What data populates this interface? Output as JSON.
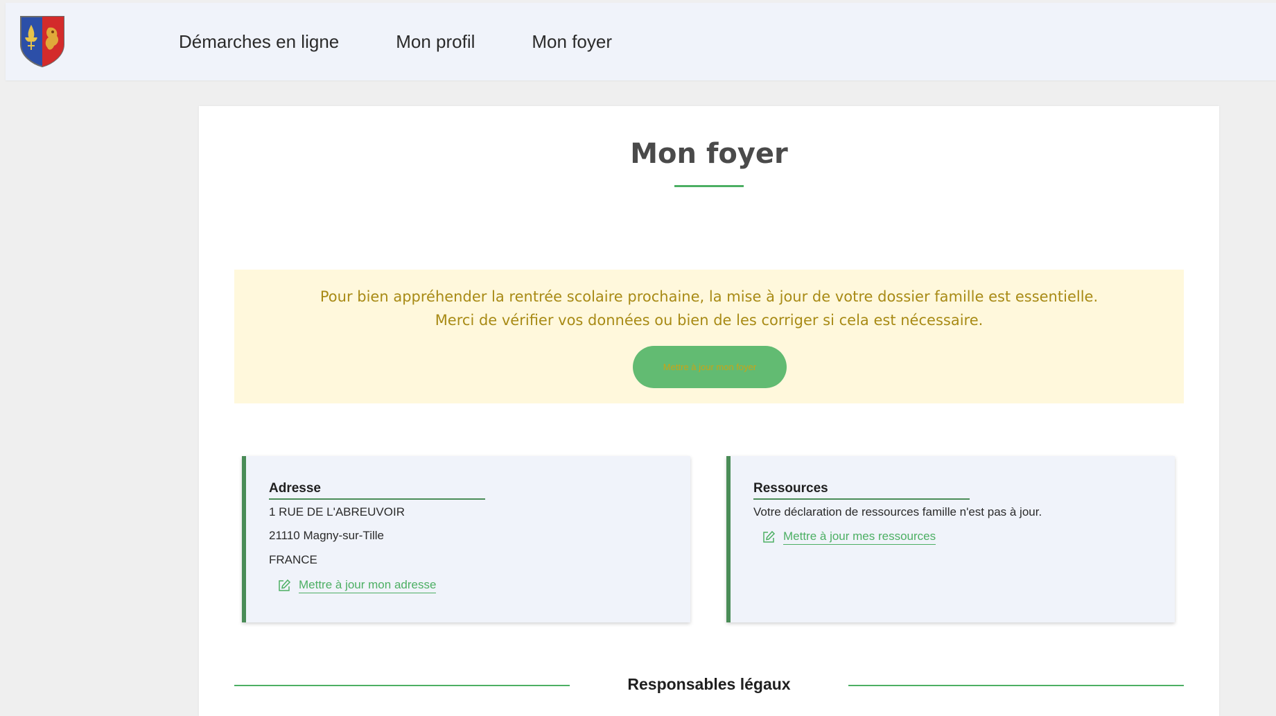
{
  "nav": {
    "items": [
      "Démarches en ligne",
      "Mon profil",
      "Mon foyer"
    ]
  },
  "page": {
    "title": "Mon foyer"
  },
  "notice": {
    "line1": "Pour bien appréhender la rentrée scolaire prochaine, la mise à jour de votre dossier famille est essentielle.",
    "line2": "Merci de vérifier vos données ou bien de les corriger si cela est nécessaire.",
    "button_label": "Mettre à jour mon foyer"
  },
  "address": {
    "title": "Adresse",
    "street": "1 RUE DE L'ABREUVOIR",
    "city": "21110 Magny-sur-Tille",
    "country": "FRANCE",
    "edit_label": "Mettre à jour mon adresse"
  },
  "resources": {
    "title": "Ressources",
    "status": "Votre déclaration de ressources famille n'est pas à jour.",
    "edit_label": "Mettre à jour mes ressources"
  },
  "section": {
    "legal_guardians": "Responsables légaux"
  },
  "colors": {
    "accent_green": "#4caf63",
    "box_border_green": "#4a8c57",
    "notice_bg": "#fff8dc",
    "notice_text": "#a88a15",
    "header_bg": "#f0f3fa"
  },
  "icons": {
    "logo": "coat-of-arms-logo",
    "edit": "edit-pencil-icon"
  }
}
